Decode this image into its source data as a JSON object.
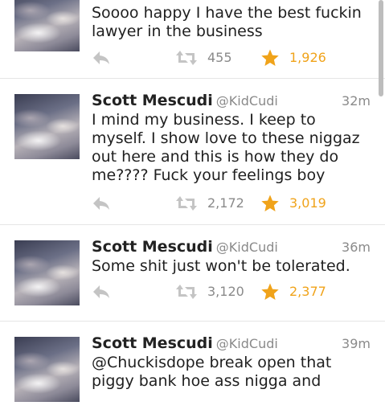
{
  "colors": {
    "favorite": "#f0a31a",
    "muted": "#8a8a8a",
    "divider": "#e6e6e6"
  },
  "icons": {
    "reply": "reply-arrow",
    "retweet": "retweet-arrows",
    "favorite": "star"
  },
  "tweets": [
    {
      "name": "",
      "handle": "",
      "time": "",
      "text": "Soooo happy I have the best fuckin lawyer in the business",
      "retweets": "455",
      "favorites": "1,926"
    },
    {
      "name": "Scott Mescudi",
      "handle": "@KidCudi",
      "time": "32m",
      "text": "I mind my business. I keep to myself. I show love to these niggaz out here and this is how they do me???? Fuck your feelings boy",
      "retweets": "2,172",
      "favorites": "3,019"
    },
    {
      "name": "Scott Mescudi",
      "handle": "@KidCudi",
      "time": "36m",
      "text": "Some shit just won't be tolerated.",
      "retweets": "3,120",
      "favorites": "2,377"
    },
    {
      "name": "Scott Mescudi",
      "handle": "@KidCudi",
      "time": "39m",
      "text": "@Chuckisdope break open that piggy bank hoe ass nigga and",
      "retweets": "",
      "favorites": ""
    }
  ]
}
